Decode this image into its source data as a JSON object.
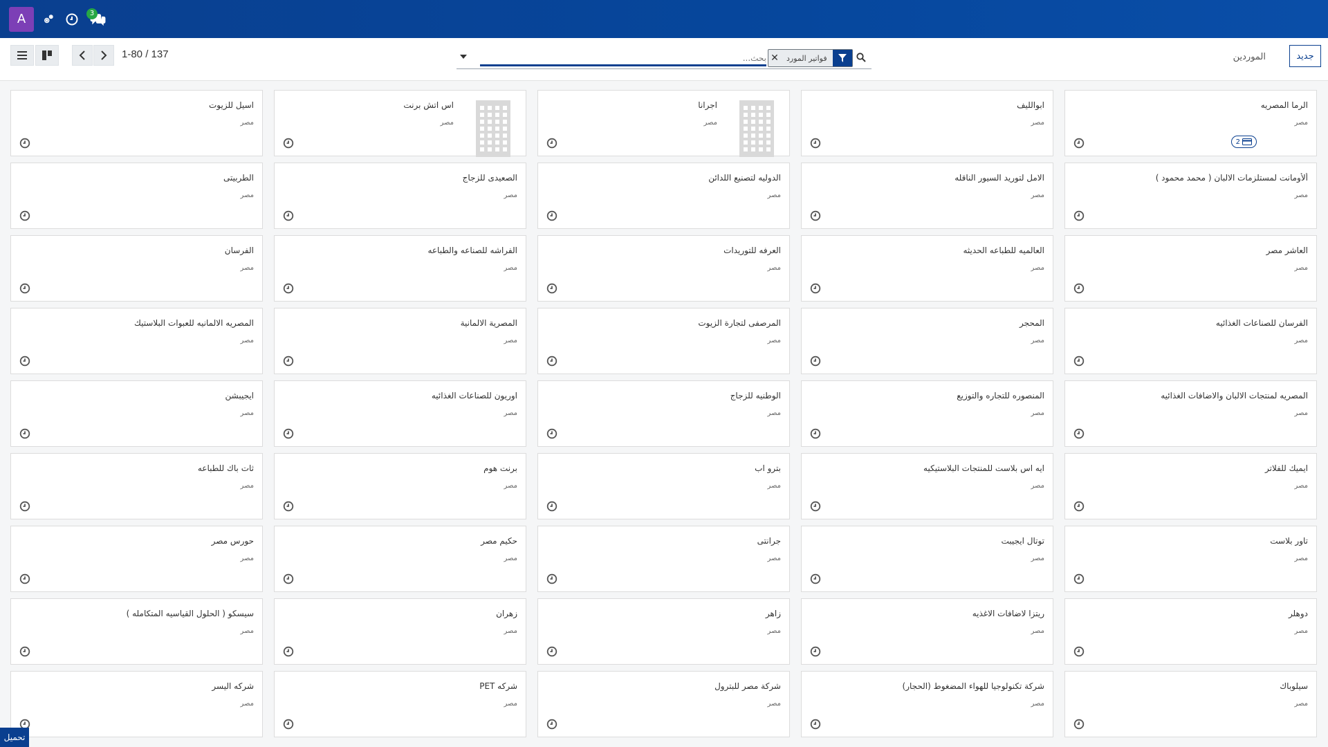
{
  "navbar": {
    "avatar_letter": "A",
    "icons": [
      "cogs-icon",
      "clock-icon",
      "chat-icon"
    ],
    "message_count": "3"
  },
  "control": {
    "pager": "1-80 / 137",
    "search_placeholder": "بحث...",
    "facet_label": "فواتير المورد",
    "breadcrumb": "الموردين",
    "new_button": "جديد"
  },
  "load_more": "تحميل",
  "cards": [
    {
      "title": "اسيل للزيوت",
      "country": "مصر"
    },
    {
      "title": "اس اتش برنت",
      "country": "مصر",
      "image": true
    },
    {
      "title": "اجرانا",
      "country": "مصر",
      "image": true
    },
    {
      "title": "ابوالليف",
      "country": "مصر"
    },
    {
      "title": "الرما المصريه",
      "country": "مصر",
      "tag": "2"
    },
    {
      "title": "الطربيتى",
      "country": "مصر"
    },
    {
      "title": "الصعيدى للزجاج",
      "country": "مصر"
    },
    {
      "title": "الدوليه لتصنيع اللدائن",
      "country": "مصر"
    },
    {
      "title": "الامل لتوريد السيور الناقله",
      "country": "مصر"
    },
    {
      "title": "ألأومانت لمستلزمات الالبان ( محمد محمود )",
      "country": "مصر"
    },
    {
      "title": "الفرسان",
      "country": "مصر"
    },
    {
      "title": "الفراشه للصناعه والطباعه",
      "country": "مصر"
    },
    {
      "title": "العرفه للتوريدات",
      "country": "مصر"
    },
    {
      "title": "العالميه للطباعه الحديثه",
      "country": "مصر"
    },
    {
      "title": "العاشر مصر",
      "country": "مصر"
    },
    {
      "title": "المصريه الالمانيه للعبوات البلاستيك",
      "country": "مصر"
    },
    {
      "title": "المصرية الالمانية",
      "country": "مصر"
    },
    {
      "title": "المرصفى لتجارة الزيوت",
      "country": "مصر"
    },
    {
      "title": "المحجر",
      "country": "مصر"
    },
    {
      "title": "الفرسان للصناعات الغذائيه",
      "country": "مصر"
    },
    {
      "title": "ايجيبشن",
      "country": "مصر"
    },
    {
      "title": "اوريون للصناعات الغذائيه",
      "country": "مصر"
    },
    {
      "title": "الوطنيه للزجاج",
      "country": "مصر"
    },
    {
      "title": "المنصوره للتجاره والتوزيع",
      "country": "مصر"
    },
    {
      "title": "المصريه لمنتجات الالبان والاضافات الغذائيه",
      "country": "مصر"
    },
    {
      "title": "ثات باك للطباعه",
      "country": "مصر"
    },
    {
      "title": "برنت هوم",
      "country": "مصر"
    },
    {
      "title": "بترو اب",
      "country": "مصر"
    },
    {
      "title": "ايه اس بلاست للمنتجات البلاستيكيه",
      "country": "مصر"
    },
    {
      "title": "ايميك للفلاتر",
      "country": "مصر"
    },
    {
      "title": "حورس مصر",
      "country": "مصر"
    },
    {
      "title": "حكيم مصر",
      "country": "مصر"
    },
    {
      "title": "جرانتى",
      "country": "مصر"
    },
    {
      "title": "توتال ايجيبت",
      "country": "مصر"
    },
    {
      "title": "تاور بلاست",
      "country": "مصر"
    },
    {
      "title": "سيسكو ( الحلول القياسيه المتكامله )",
      "country": "مصر"
    },
    {
      "title": "زهران",
      "country": "مصر"
    },
    {
      "title": "زاهر",
      "country": "مصر"
    },
    {
      "title": "ريتزا لاضافات الاغذيه",
      "country": "مصر"
    },
    {
      "title": "دوهلر",
      "country": "مصر"
    },
    {
      "title": "شركه اليسر",
      "country": "مصر"
    },
    {
      "title": "شركه PET",
      "country": "مصر"
    },
    {
      "title": "شركة مصر للبترول",
      "country": "مصر"
    },
    {
      "title": "شركة تكنولوجيا للهواء المضغوط (الحجار)",
      "country": "مصر"
    },
    {
      "title": "سيلوباك",
      "country": "مصر"
    }
  ]
}
